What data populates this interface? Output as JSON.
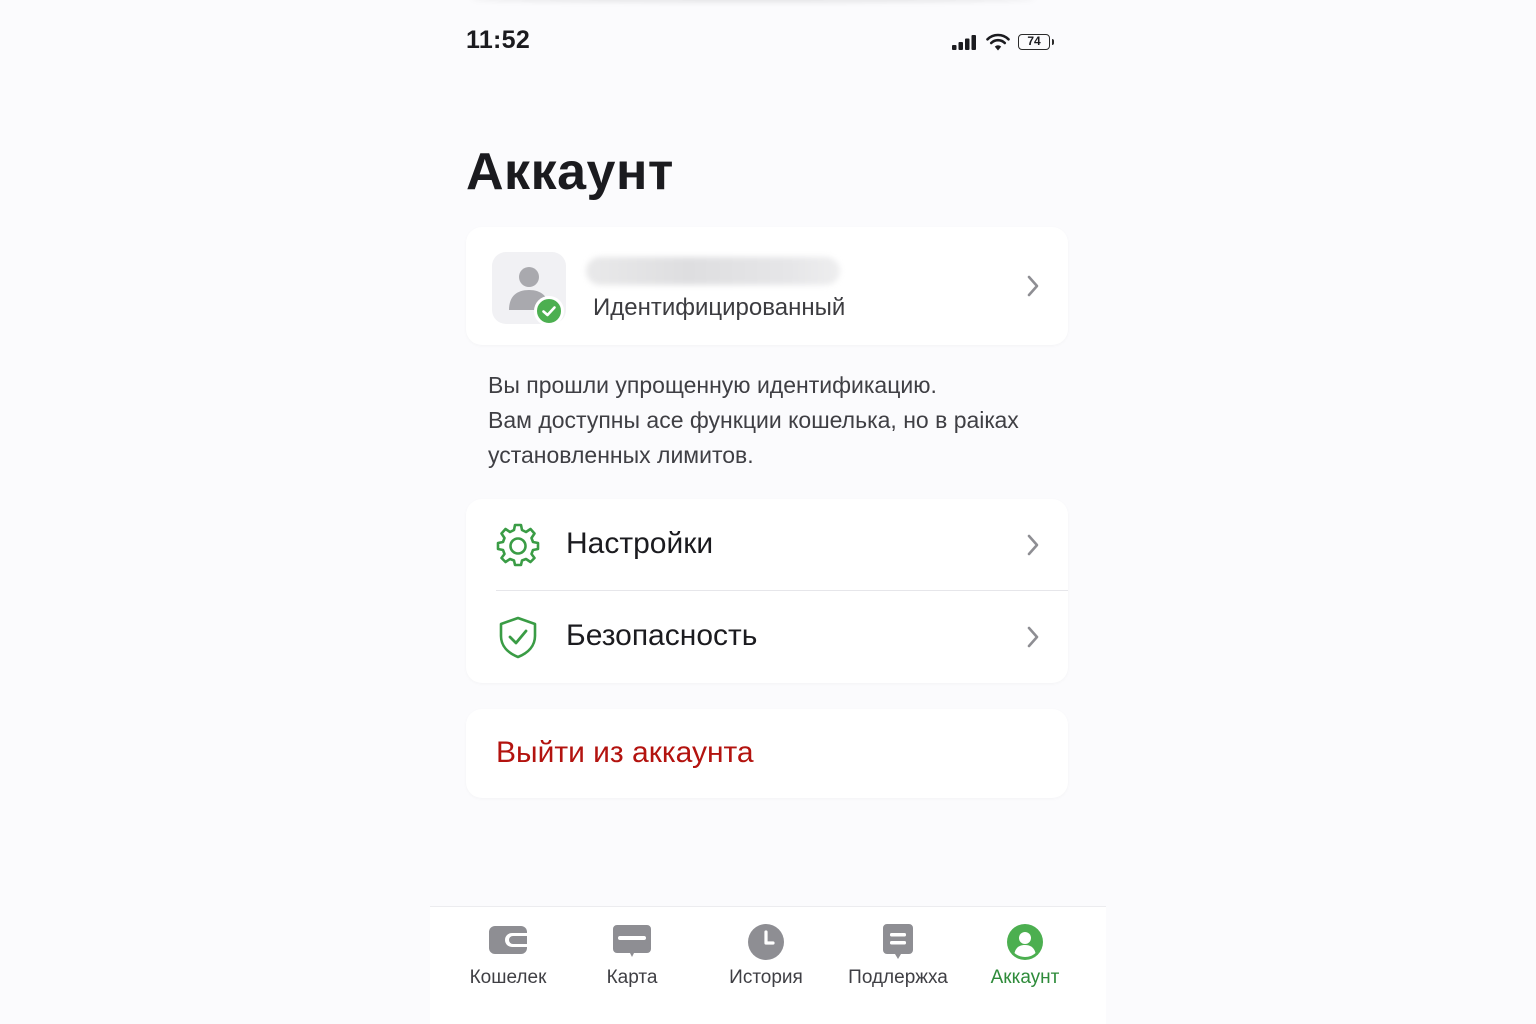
{
  "status_bar": {
    "time": "11:52",
    "battery_level": "74",
    "icons": [
      "cellular-signal-icon",
      "wifi-icon",
      "battery-icon"
    ]
  },
  "header": {
    "title": "Аккаунт"
  },
  "profile": {
    "status": "Идентифицированный",
    "avatar_icon": "user-icon",
    "badge_icon": "check-icon"
  },
  "info": {
    "lines": [
      "Вы прошли упрощенную идентификацию.",
      "Вам доступны асе функции кошелька, но в раікax",
      "установленных лимитов."
    ]
  },
  "menu": {
    "items": [
      {
        "label": "Настройки",
        "icon": "gear-icon"
      },
      {
        "label": "Безопасность",
        "icon": "shield-check-icon"
      }
    ]
  },
  "logout": {
    "label": "Выйти из аккаунта"
  },
  "tabbar": {
    "tabs": [
      {
        "label": "Кошелек",
        "icon": "wallet-icon",
        "active": false
      },
      {
        "label": "Карта",
        "icon": "card-icon",
        "active": false
      },
      {
        "label": "История",
        "icon": "clock-icon",
        "active": false
      },
      {
        "label": "Подлержха",
        "icon": "support-icon",
        "active": false
      },
      {
        "label": "Аккаунт",
        "icon": "account-icon",
        "active": true
      }
    ]
  },
  "colors": {
    "accent_green": "#4caf50",
    "active_tab_green": "#2e8b3a",
    "logout_red": "#b3130f",
    "inactive_icon_gray": "#8e8e93",
    "background": "#fbfbfd"
  }
}
